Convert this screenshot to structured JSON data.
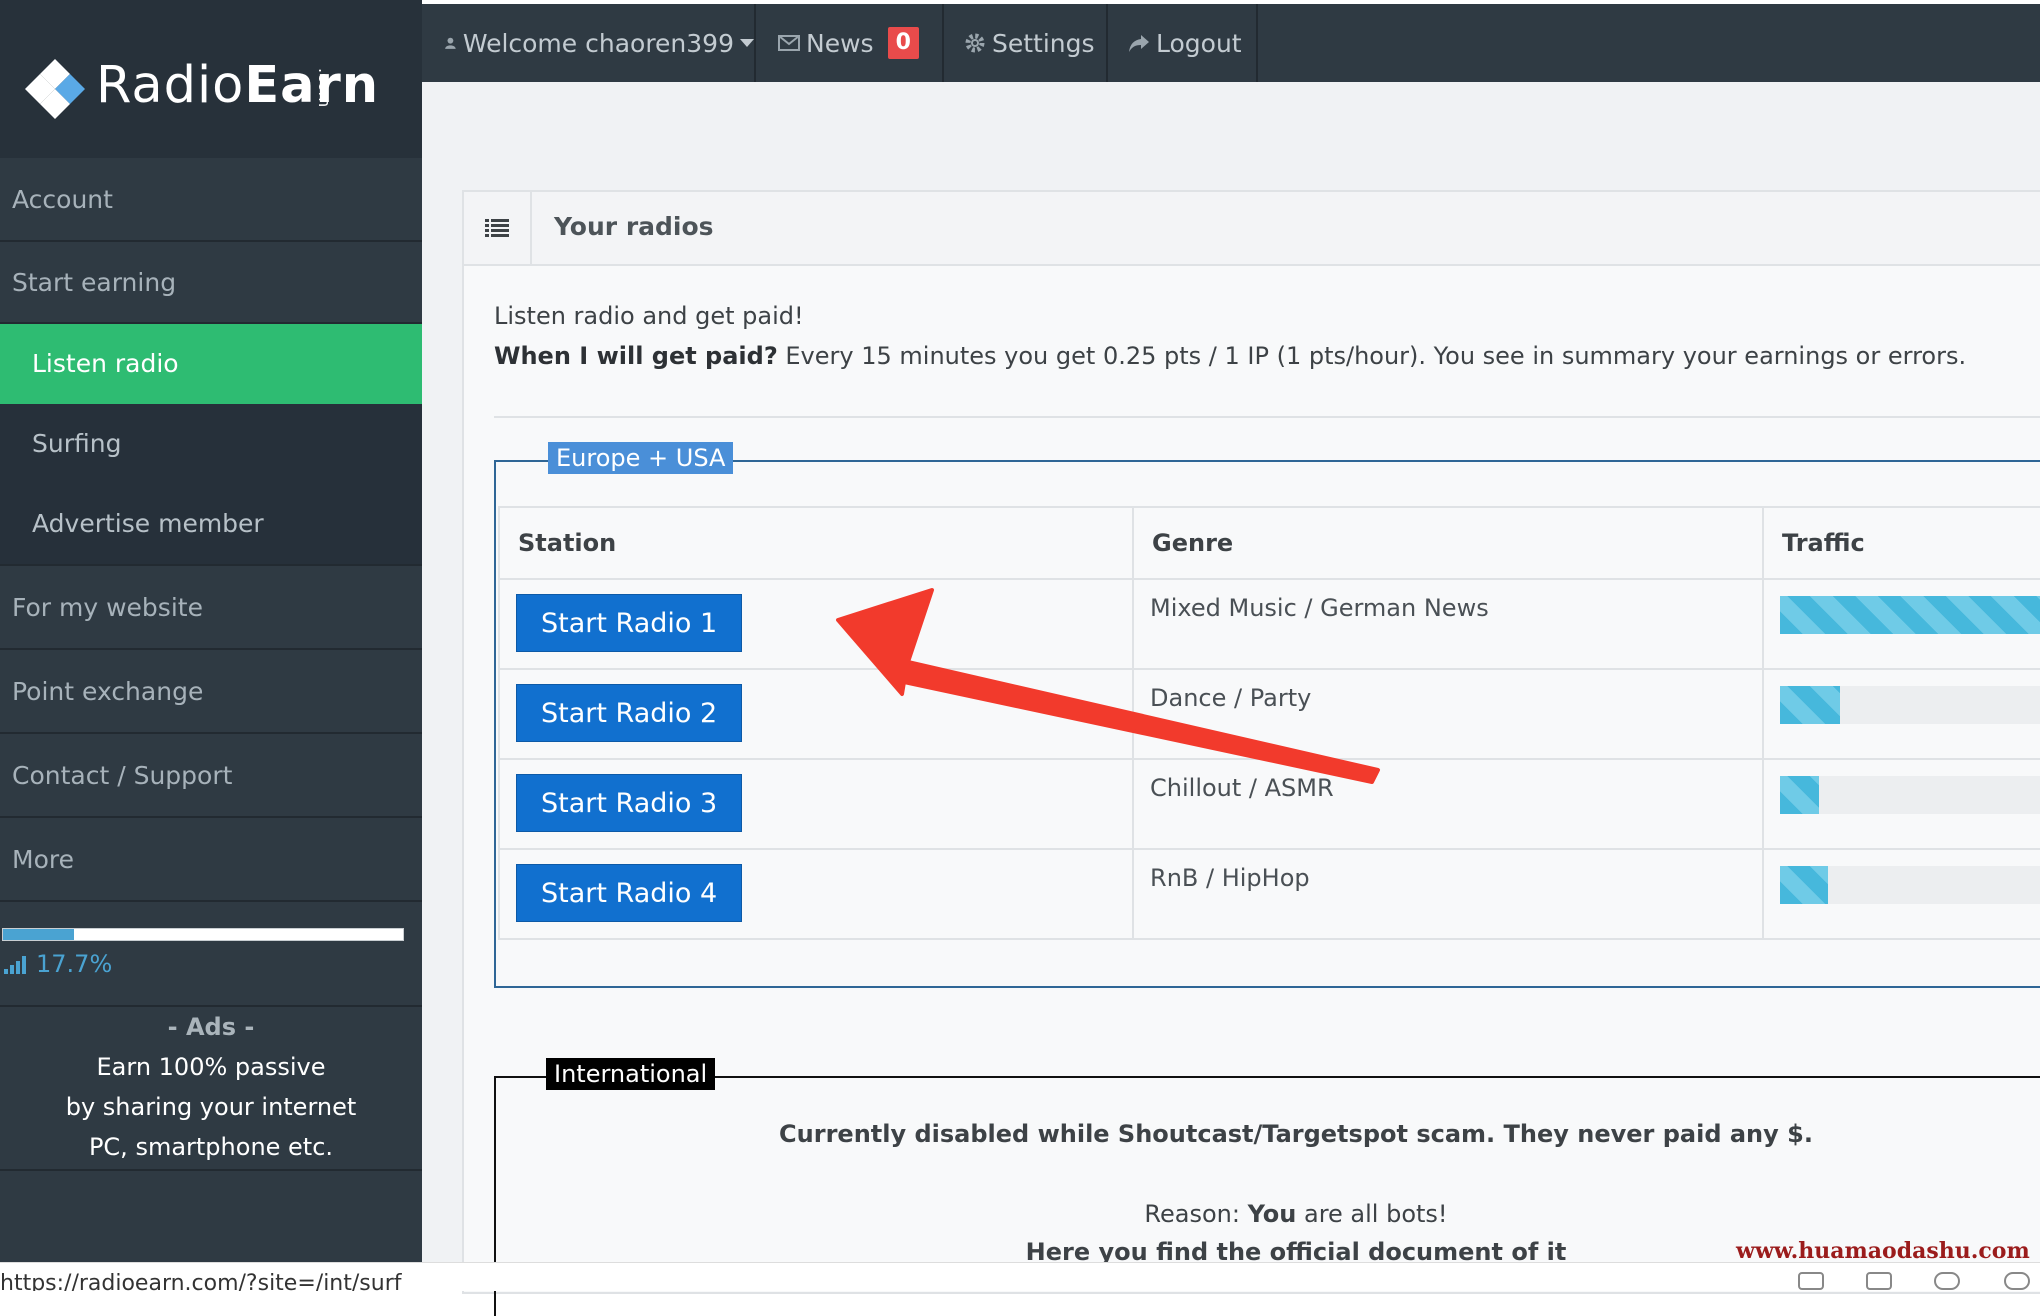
{
  "brand": {
    "name_light": "Radio",
    "name_bold": "Earn",
    "suffix": ".com"
  },
  "topbar": {
    "welcome": "Welcome chaoren399",
    "news": "News",
    "news_count": "0",
    "settings": "Settings",
    "logout": "Logout"
  },
  "sidebar": {
    "items": [
      {
        "label": "Account"
      },
      {
        "label": "Start earning"
      },
      {
        "label": "Listen radio",
        "active": true
      },
      {
        "label": "Surfing"
      },
      {
        "label": "Advertise member"
      },
      {
        "label": "For my website"
      },
      {
        "label": "Point exchange"
      },
      {
        "label": "Contact / Support"
      },
      {
        "label": "More"
      }
    ],
    "progress_percent": 17.7,
    "progress_label": "17.7%",
    "ads": {
      "heading": "- Ads -",
      "line1": "Earn 100% passive",
      "line2": "by sharing your internet",
      "line3": "PC, smartphone etc."
    }
  },
  "panel": {
    "title": "Your radios",
    "intro1": "Listen radio and get paid!",
    "intro2_bold": "When I will get paid?",
    "intro2_rest": " Every 15 minutes you get 0.25 pts / 1 IP (1 pts/hour). You see in summary your earnings or errors."
  },
  "europe": {
    "legend": "Europe + USA",
    "headers": {
      "station": "Station",
      "genre": "Genre",
      "traffic": "Traffic"
    },
    "rows": [
      {
        "button": "Start Radio 1",
        "genre": "Mixed Music / German News",
        "traffic": 1.0
      },
      {
        "button": "Start Radio 2",
        "genre": "Dance / Party",
        "traffic": 0.2
      },
      {
        "button": "Start Radio 3",
        "genre": "Chillout / ASMR",
        "traffic": 0.13
      },
      {
        "button": "Start Radio 4",
        "genre": "RnB / HipHop",
        "traffic": 0.16
      }
    ]
  },
  "international": {
    "legend": "International",
    "notice": "Currently disabled while Shoutcast/Targetspot scam. They never paid any $.",
    "reason_prefix": "Reason: ",
    "reason_bold": "You",
    "reason_rest": " are all bots!",
    "document_line": "Here you find the official document of it"
  },
  "statusbar": {
    "url": "https://radioearn.com/?site=/int/surf"
  },
  "watermark": "www.huamaodashu.com",
  "colors": {
    "sidebar": "#2f3a43",
    "active": "#2ebc72",
    "button": "#1170cf",
    "legend_blue": "#4a8fd8",
    "arrow": "#f23a2c"
  }
}
